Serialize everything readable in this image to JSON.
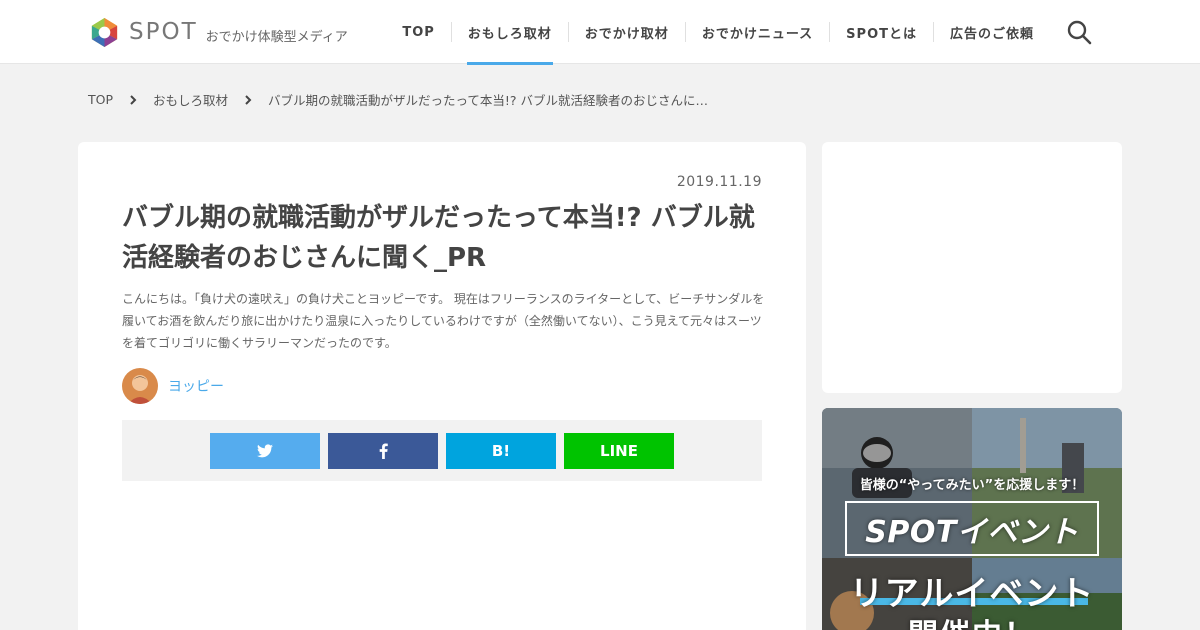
{
  "header": {
    "logo_text": "SPOT",
    "tagline": "おでかけ体験型メディア",
    "nav": [
      {
        "label": "TOP"
      },
      {
        "label": "おもしろ取材"
      },
      {
        "label": "おでかけ取材"
      },
      {
        "label": "おでかけニュース"
      },
      {
        "label": "SPOTとは"
      },
      {
        "label": "広告のご依頼"
      }
    ],
    "active_nav": "おもしろ取材"
  },
  "breadcrumb": [
    "TOP",
    "おもしろ取材",
    "バブル期の就職活動がザルだったって本当!? バブル就活経験者のおじさんに…"
  ],
  "article": {
    "date": "2019.11.19",
    "title": "バブル期の就職活動がザルだったって本当!? バブル就活経験者のおじさんに聞く_PR",
    "lead": "こんにちは。「負け犬の遠吠え」の負け犬ことヨッピーです。 現在はフリーランスのライターとして、ビーチサンダルを履いてお酒を飲んだり旅に出かけたり温泉に入ったりしているわけですが（全然働いてない）、こう見えて元々はスーツを着てゴリゴリに働くサラリーマンだったのです。",
    "author": "ヨッピー"
  },
  "share": {
    "hatena_label": "B!",
    "line_label": "LINE"
  },
  "sidebar": {
    "event_tagline": "皆様の“やってみたい”を応援します！",
    "event_title": "SPOTイベント",
    "event_real": "リアルイベント",
    "event_open": "開催中！"
  },
  "colors": {
    "accent": "#4aa9e9",
    "twitter": "#55acee",
    "facebook": "#3b5998",
    "hatena": "#00a4de",
    "line": "#00c300"
  }
}
